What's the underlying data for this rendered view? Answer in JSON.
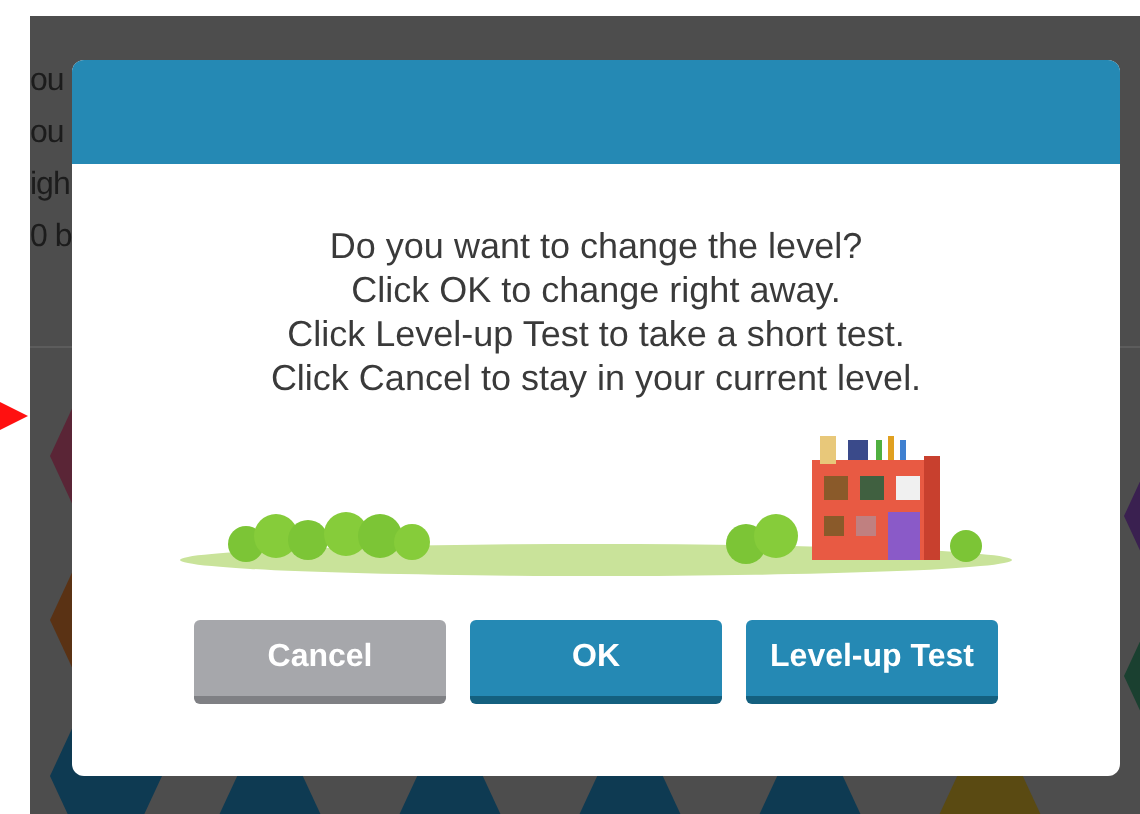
{
  "background_text": [
    "ou",
    "ou",
    "igh",
    "0 b"
  ],
  "dialog": {
    "message": [
      "Do you want to change the level?",
      "Click OK to change right away.",
      "Click Level-up Test to take a short test.",
      "Click Cancel to stay in your current level."
    ],
    "buttons": [
      {
        "label": "Cancel",
        "kind": "secondary"
      },
      {
        "label": "OK",
        "kind": "primary"
      },
      {
        "label": "Level-up Test",
        "kind": "primary"
      }
    ]
  }
}
